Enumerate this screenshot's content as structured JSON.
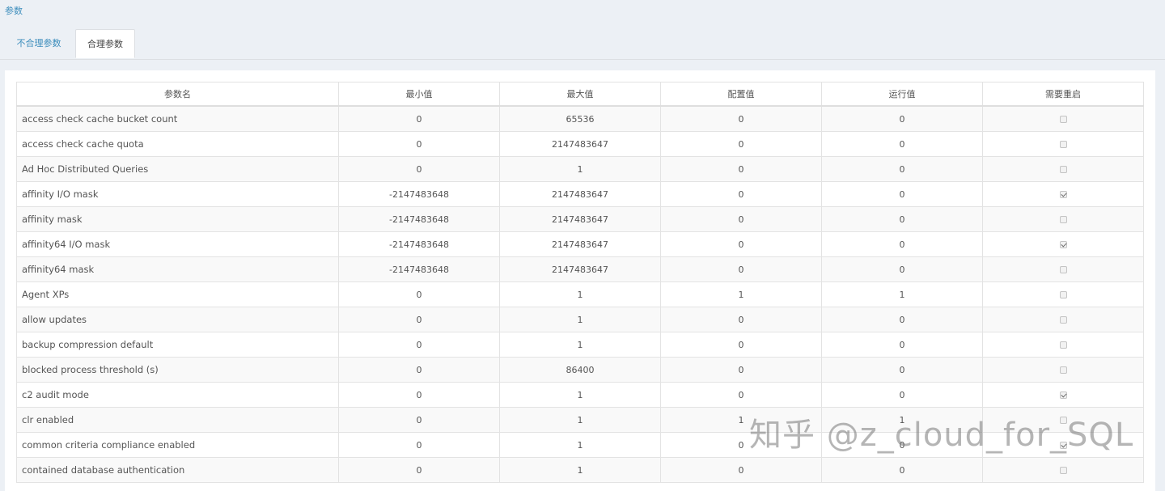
{
  "breadcrumb": "参数",
  "tabs": [
    {
      "label": "不合理参数",
      "active": false
    },
    {
      "label": "合理参数",
      "active": true
    }
  ],
  "table": {
    "columns": [
      "参数名",
      "最小值",
      "最大值",
      "配置值",
      "运行值",
      "需要重启"
    ],
    "rows": [
      {
        "name": "access check cache bucket count",
        "min": "0",
        "max": "65536",
        "config": "0",
        "run": "0",
        "restart": false
      },
      {
        "name": "access check cache quota",
        "min": "0",
        "max": "2147483647",
        "config": "0",
        "run": "0",
        "restart": false
      },
      {
        "name": "Ad Hoc Distributed Queries",
        "min": "0",
        "max": "1",
        "config": "0",
        "run": "0",
        "restart": false
      },
      {
        "name": "affinity I/O mask",
        "min": "-2147483648",
        "max": "2147483647",
        "config": "0",
        "run": "0",
        "restart": true
      },
      {
        "name": "affinity mask",
        "min": "-2147483648",
        "max": "2147483647",
        "config": "0",
        "run": "0",
        "restart": false
      },
      {
        "name": "affinity64 I/O mask",
        "min": "-2147483648",
        "max": "2147483647",
        "config": "0",
        "run": "0",
        "restart": true
      },
      {
        "name": "affinity64 mask",
        "min": "-2147483648",
        "max": "2147483647",
        "config": "0",
        "run": "0",
        "restart": false
      },
      {
        "name": "Agent XPs",
        "min": "0",
        "max": "1",
        "config": "1",
        "run": "1",
        "restart": false
      },
      {
        "name": "allow updates",
        "min": "0",
        "max": "1",
        "config": "0",
        "run": "0",
        "restart": false
      },
      {
        "name": "backup compression default",
        "min": "0",
        "max": "1",
        "config": "0",
        "run": "0",
        "restart": false
      },
      {
        "name": "blocked process threshold (s)",
        "min": "0",
        "max": "86400",
        "config": "0",
        "run": "0",
        "restart": false
      },
      {
        "name": "c2 audit mode",
        "min": "0",
        "max": "1",
        "config": "0",
        "run": "0",
        "restart": true
      },
      {
        "name": "clr enabled",
        "min": "0",
        "max": "1",
        "config": "1",
        "run": "1",
        "restart": false
      },
      {
        "name": "common criteria compliance enabled",
        "min": "0",
        "max": "1",
        "config": "0",
        "run": "0",
        "restart": true
      },
      {
        "name": "contained database authentication",
        "min": "0",
        "max": "1",
        "config": "0",
        "run": "0",
        "restart": false
      }
    ]
  },
  "watermark": "知乎 @z_cloud_for_SQL"
}
